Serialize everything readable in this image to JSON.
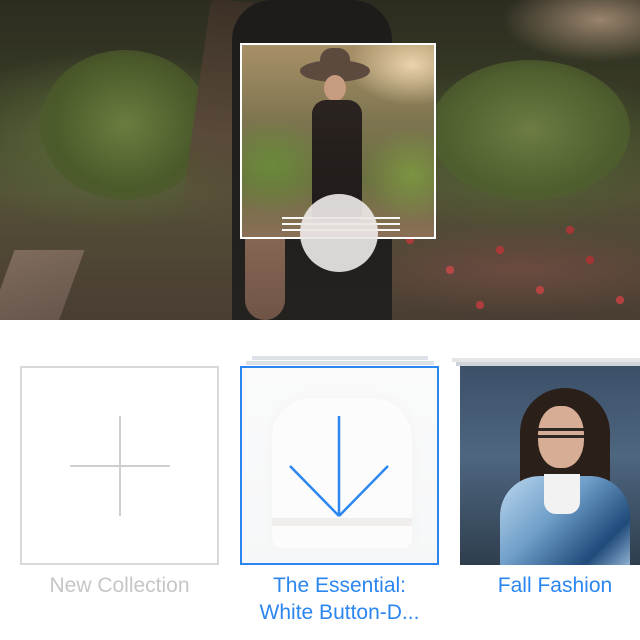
{
  "collections": {
    "new_collection": {
      "label": "New Collection"
    },
    "essential": {
      "label_line1": "The Essential:",
      "label_line2": "White Button-D..."
    },
    "fall_fashion": {
      "label": "Fall Fashion"
    }
  },
  "colors": {
    "accent": "#2b86f0",
    "muted_text": "#c6c6c6",
    "tile_border": "#d8d8d8"
  },
  "icons": {
    "plus": "plus-icon",
    "drop_arrow": "arrow-down-icon"
  }
}
